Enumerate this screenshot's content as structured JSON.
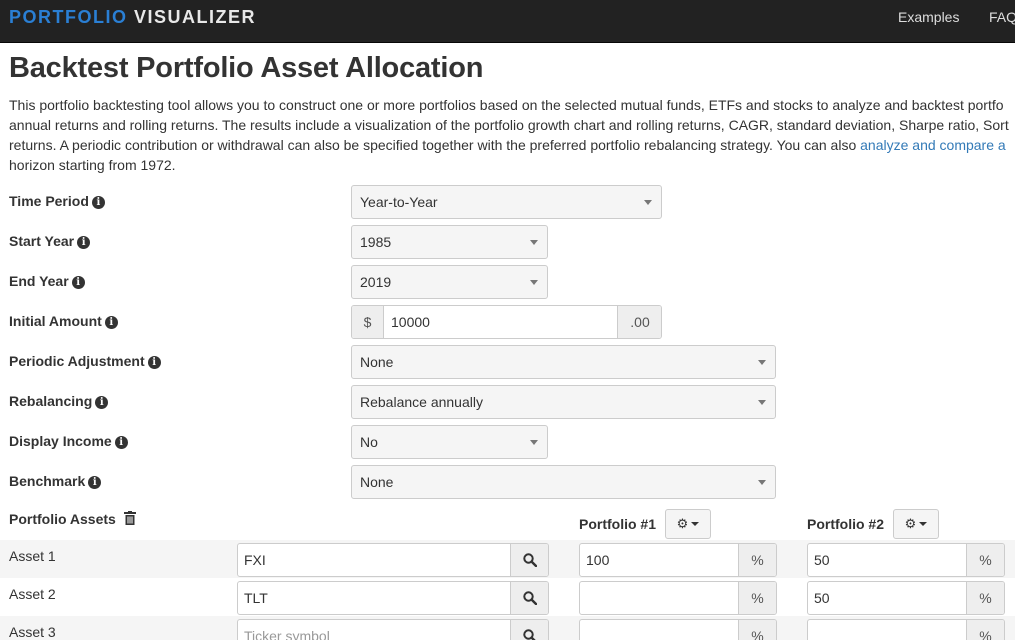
{
  "navbar": {
    "brand_part1": "PORTFOLIO",
    "brand_part2": "VISUALIZER",
    "links": [
      "Examples",
      "FAQ"
    ]
  },
  "page": {
    "title": "Backtest Portfolio Asset Allocation",
    "description_lines": [
      "This portfolio backtesting tool allows you to construct one or more portfolios based on the selected mutual funds, ETFs and stocks to analyze and backtest portfo",
      "annual returns and rolling returns. The results include a visualization of the portfolio growth chart and rolling returns, CAGR, standard deviation, Sharpe ratio, Sort",
      "returns. A periodic contribution or withdrawal can also be specified together with the preferred portfolio rebalancing strategy. You can also ",
      "horizon starting from 1972."
    ],
    "description_link": "analyze and compare a"
  },
  "form": {
    "time_period": {
      "label": "Time Period",
      "value": "Year-to-Year"
    },
    "start_year": {
      "label": "Start Year",
      "value": "1985"
    },
    "end_year": {
      "label": "End Year",
      "value": "2019"
    },
    "initial_amount": {
      "label": "Initial Amount",
      "prefix": "$",
      "value": "10000",
      "suffix": ".00"
    },
    "periodic_adjustment": {
      "label": "Periodic Adjustment",
      "value": "None"
    },
    "rebalancing": {
      "label": "Rebalancing",
      "value": "Rebalance annually"
    },
    "display_income": {
      "label": "Display Income",
      "value": "No"
    },
    "benchmark": {
      "label": "Benchmark",
      "value": "None"
    }
  },
  "assets": {
    "section_label": "Portfolio Assets",
    "portfolio1_label": "Portfolio #1",
    "portfolio2_label": "Portfolio #2",
    "ticker_placeholder": "Ticker symbol",
    "percent_sign": "%",
    "rows": [
      {
        "label": "Asset 1",
        "ticker": "FXI",
        "p1": "100",
        "p2": "50"
      },
      {
        "label": "Asset 2",
        "ticker": "TLT",
        "p1": "",
        "p2": "50"
      },
      {
        "label": "Asset 3",
        "ticker": "",
        "p1": "",
        "p2": ""
      }
    ]
  },
  "icons": {
    "info": "info-circle-icon",
    "trash": "trash-icon",
    "search": "search-icon",
    "gear": "gear-icon"
  }
}
